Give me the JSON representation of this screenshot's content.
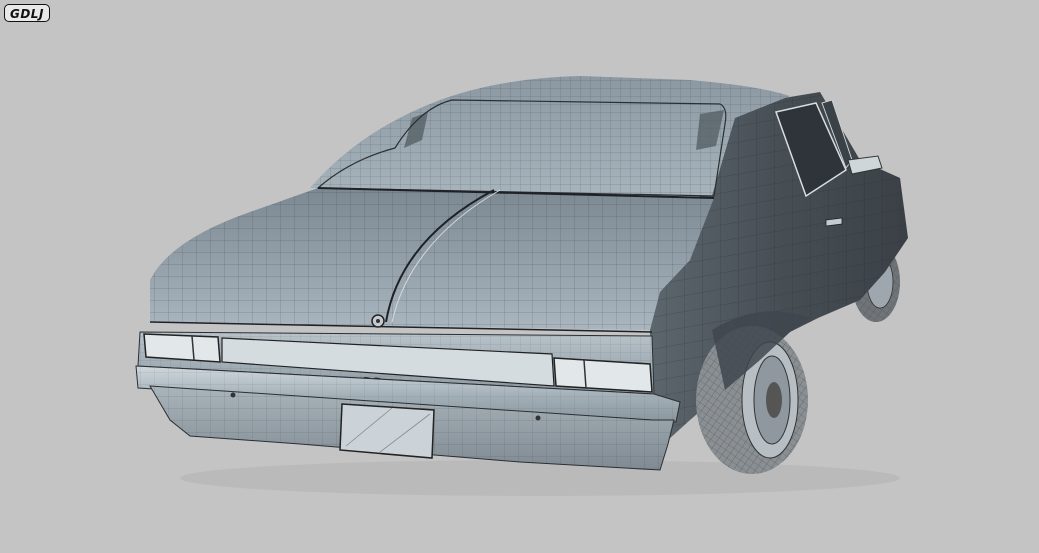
{
  "watermark": {
    "text": "GDLJ"
  },
  "car": {
    "badge_text": "SS"
  },
  "colors": {
    "background": "#c4c4c4",
    "body_light": "#9aa8b2",
    "body_mid": "#6c7880",
    "body_dark": "#3a4046",
    "wireframe": "#2a2f33",
    "glass": "#4a5258",
    "plate": "#c9d0d5"
  }
}
